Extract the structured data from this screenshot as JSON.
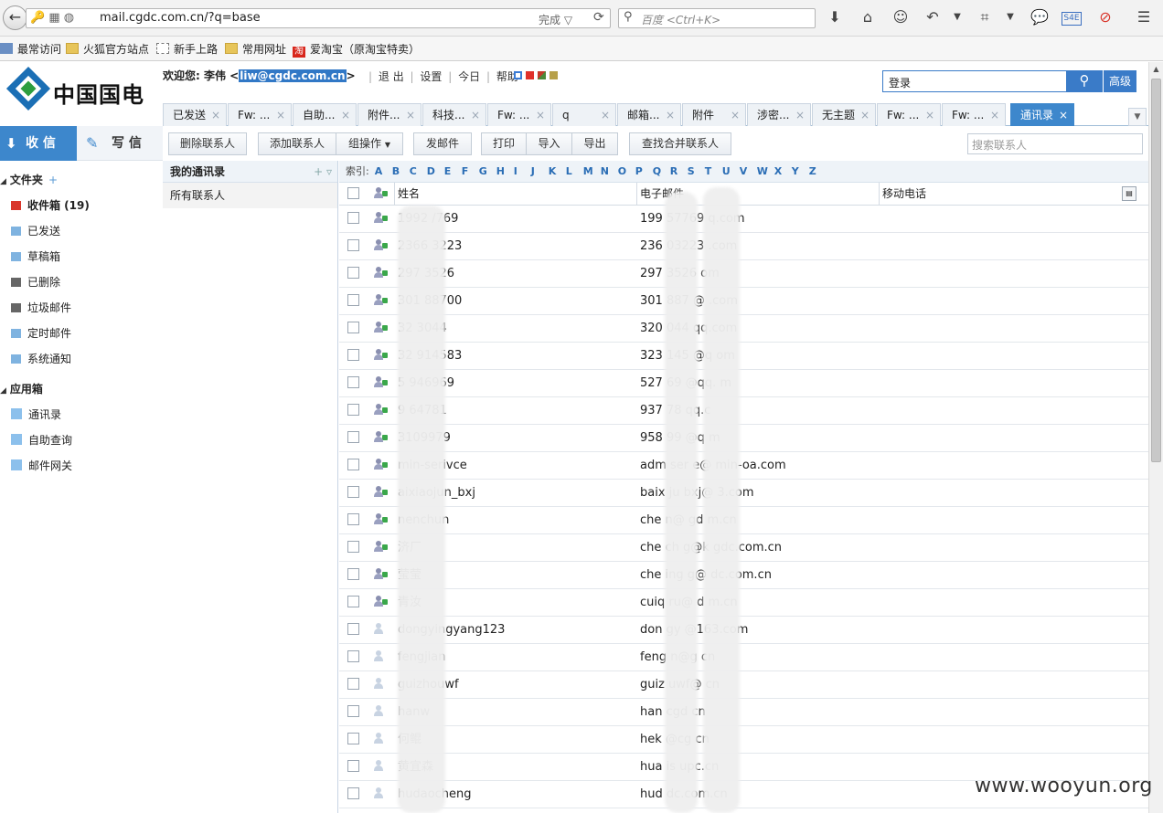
{
  "browser": {
    "url": "mail.cgdc.com.cn/?q=base",
    "status": "完成",
    "search_placeholder": "百度 <Ctrl+K>",
    "bookmarks": [
      "最常访问",
      "火狐官方站点",
      "新手上路",
      "常用网址",
      "爱淘宝（原淘宝特卖）"
    ]
  },
  "header": {
    "logo_text": "中国国电",
    "welcome_prefix": "欢迎您: 李伟 <",
    "email": "liw@cgdc.com.cn",
    "welcome_suffix": ">",
    "links": [
      "退 出",
      "设置",
      "今日",
      "帮助"
    ],
    "search_value": "登录",
    "advanced_label": "高级",
    "theme_colors": [
      "#3a7bd5",
      "#e0302a",
      "#c43a2a",
      "#b7a04a"
    ]
  },
  "tabs": [
    "已发送",
    "Fw: ...",
    "自助...",
    "附件...",
    "科技...",
    "Fw: ...",
    "q",
    "邮箱...",
    "附件",
    "涉密...",
    "无主题",
    "Fw: ...",
    "Fw: ...",
    "通讯录"
  ],
  "active_tab": "通讯录",
  "sidebar": {
    "inbox_label": "收 信",
    "compose_label": "写 信",
    "folders_title": "文件夹",
    "folders": [
      "收件箱 (19)",
      "已发送",
      "草稿箱",
      "已删除",
      "垃圾邮件",
      "定时邮件",
      "系统通知"
    ],
    "apps_title": "应用箱",
    "apps": [
      "通讯录",
      "自助查询",
      "邮件网关"
    ]
  },
  "toolbar": {
    "delete_contact": "删除联系人",
    "add_contact": "添加联系人",
    "group_ops": "组操作",
    "send_mail": "发邮件",
    "print": "打印",
    "import": "导入",
    "export": "导出",
    "merge": "查找合并联系人",
    "search_placeholder": "搜索联系人"
  },
  "groups": {
    "title": "我的通讯录",
    "all": "所有联系人"
  },
  "index": {
    "label": "索引:",
    "letters": [
      "A",
      "B",
      "C",
      "D",
      "E",
      "F",
      "G",
      "H",
      "I",
      "J",
      "K",
      "L",
      "M",
      "N",
      "O",
      "P",
      "Q",
      "R",
      "S",
      "T",
      "U",
      "V",
      "W",
      "X",
      "Y",
      "Z"
    ]
  },
  "columns": {
    "name": "姓名",
    "email": "电子邮件",
    "mobile": "移动电话"
  },
  "contacts": [
    {
      "name": "1992  /769",
      "email": "199  57769  q.com",
      "icon": "plus"
    },
    {
      "name": "2366  3223",
      "email": "236  03223  .com",
      "icon": "plus"
    },
    {
      "name": "297  3526",
      "email": "297  3526  om",
      "icon": "plus"
    },
    {
      "name": "301  88700",
      "email": "301  887  @ .com",
      "icon": "plus"
    },
    {
      "name": "32  3044",
      "email": "320  044  qq.com",
      "icon": "plus"
    },
    {
      "name": "32  914583",
      "email": "323  145  @q  om",
      "icon": "plus"
    },
    {
      "name": "5  946969",
      "email": "527  69  @qq.  m",
      "icon": "plus"
    },
    {
      "name": "9  64781",
      "email": "937  78  qq.c",
      "icon": "plus"
    },
    {
      "name": "  3109979",
      "email": "958  99  @q  m",
      "icon": "plus"
    },
    {
      "name": "  min-serivce",
      "email": "adm  ser  e@  min-oa.com",
      "icon": "plus"
    },
    {
      "name": "  aixiaojun_bxj",
      "email": "baix  ju  bxj@  3.com",
      "icon": "plus"
    },
    {
      "name": "  nenchun",
      "email": "che  n@  gd  m.cn",
      "icon": "plus"
    },
    {
      "name": "  济厂",
      "email": "che  ch  g@k  gdc.com.cn",
      "icon": "plus"
    },
    {
      "name": "  莹莹",
      "email": "che  ing  g@  dc.com.cn",
      "icon": "plus"
    },
    {
      "name": "  青汝",
      "email": "cuiq  ru@  d  m.cn",
      "icon": "plus"
    },
    {
      "name": "dongyingyang123",
      "email": "don  gy  @163.com",
      "icon": "plain"
    },
    {
      "name": "fengjian",
      "email": "feng  n@g  cn",
      "icon": "plain"
    },
    {
      "name": "guizhouwf",
      "email": "guiz  uwf@  cn",
      "icon": "plain"
    },
    {
      "name": "hanw",
      "email": "han  cgd  cn",
      "icon": "plain"
    },
    {
      "name": "何鲲",
      "email": "hek  @cg  cn",
      "icon": "plain"
    },
    {
      "name": "黄宜森",
      "email": "hua  is  upc.cn",
      "icon": "plain"
    },
    {
      "name": "hudaocheng",
      "email": "hud  dc.com.cn",
      "icon": "plain"
    }
  ],
  "watermark": "www.wooyun.org"
}
